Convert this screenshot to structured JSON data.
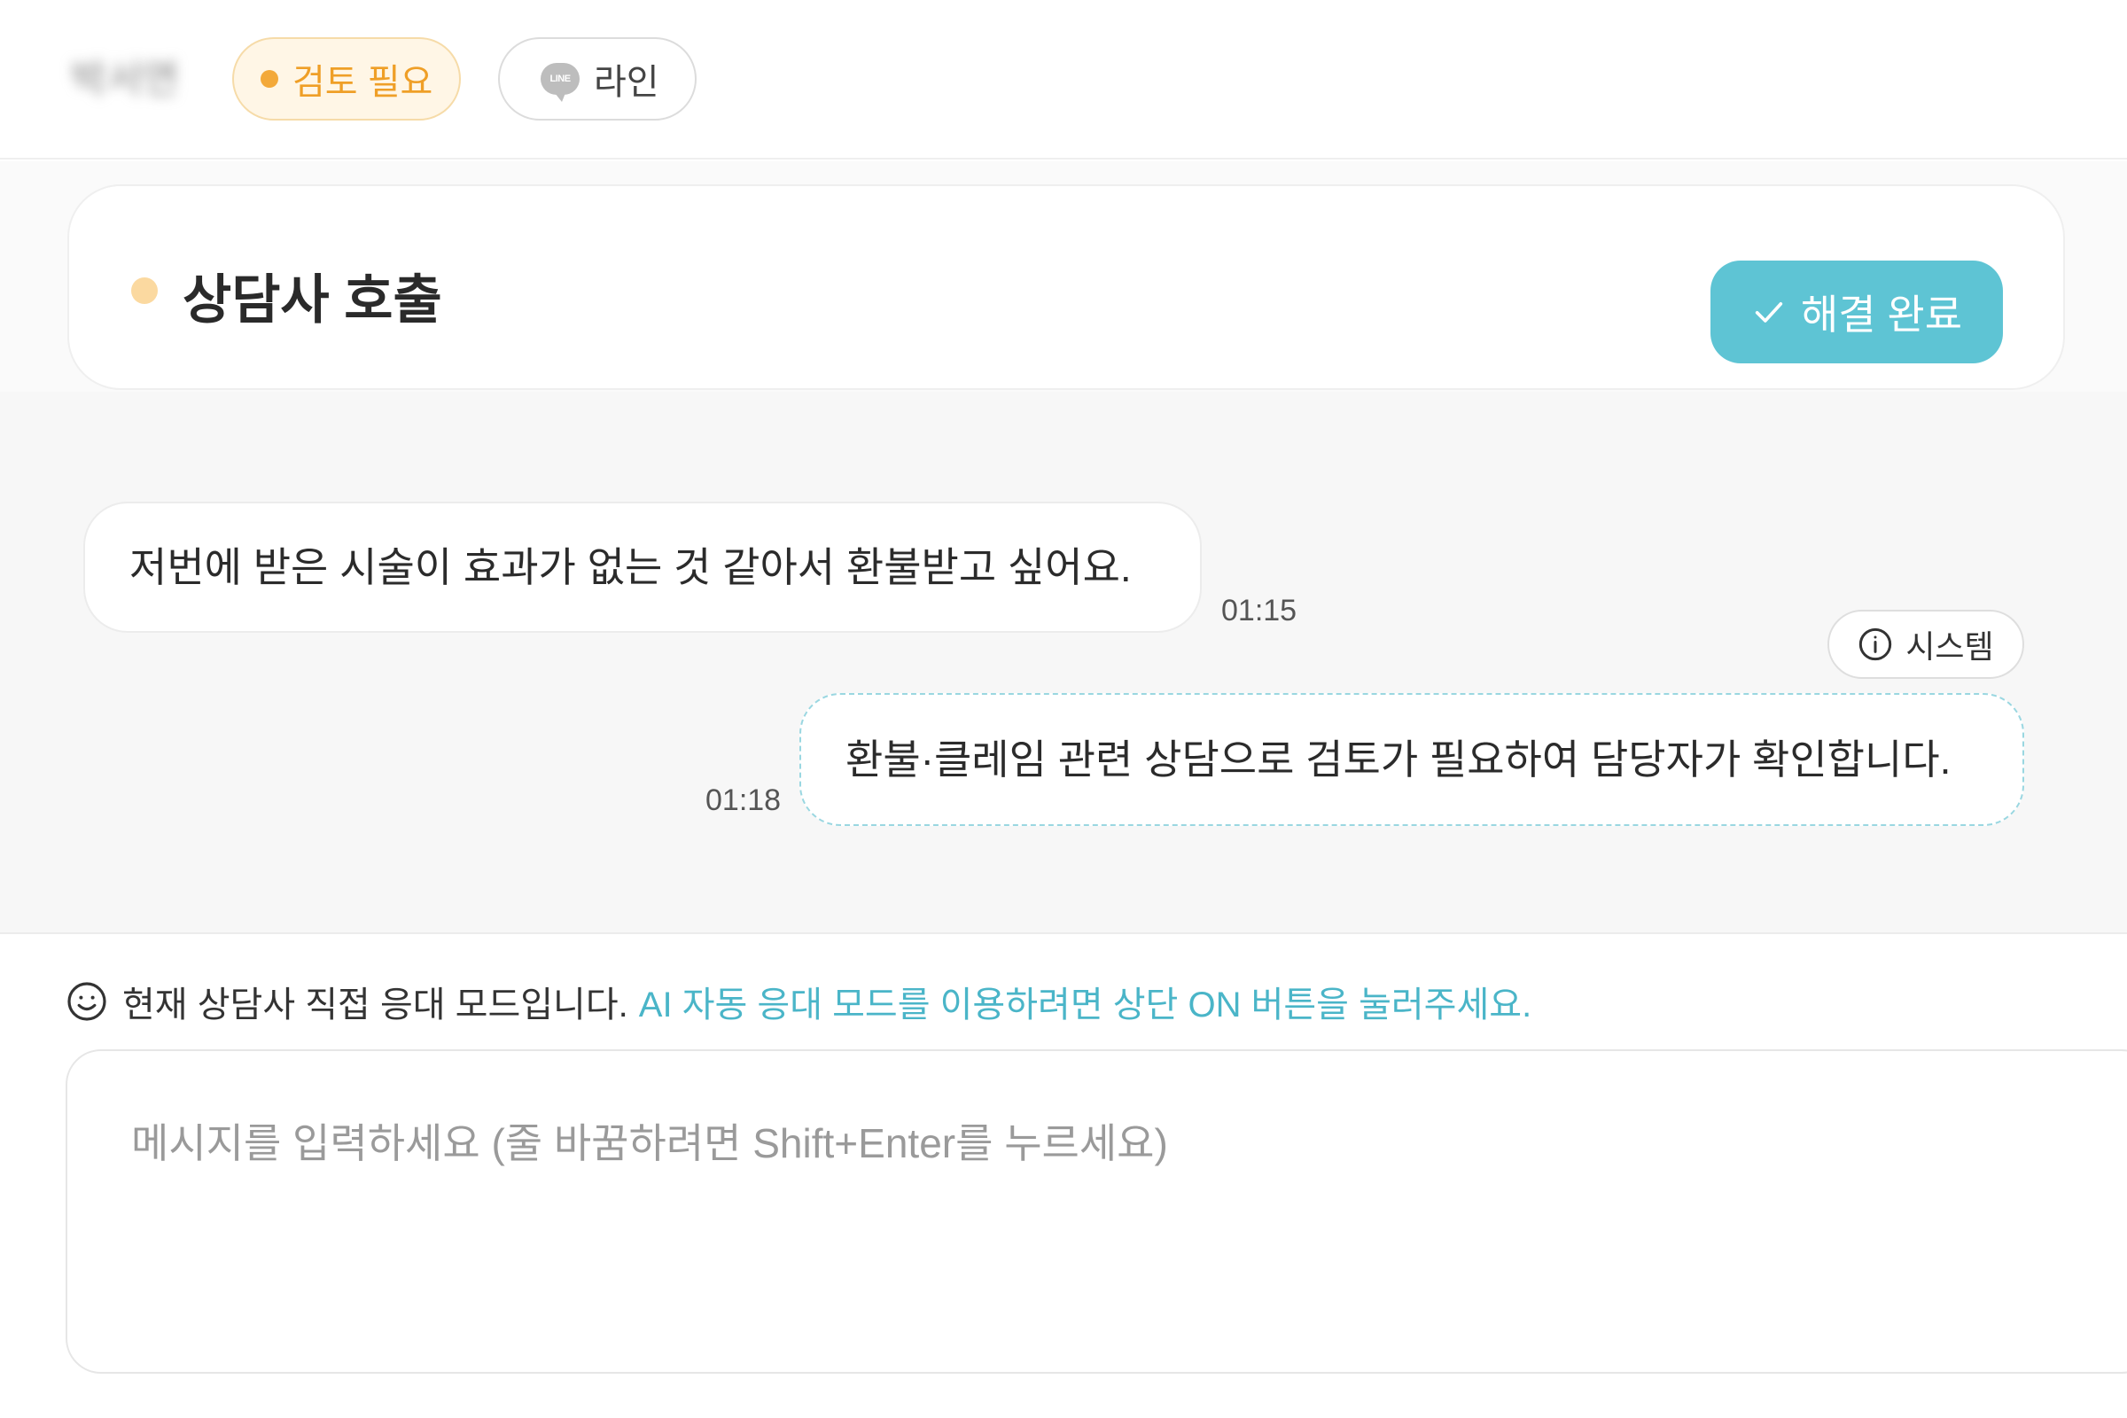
{
  "header": {
    "user_name": "박서연",
    "status_label": "검토 필요",
    "channel_label": "라인",
    "channel_icon_text": "LINE"
  },
  "call": {
    "title": "상담사 호출",
    "resolve_label": "해결 완료"
  },
  "messages": [
    {
      "type": "user",
      "text": "저번에 받은 시술이 효과가 없는 것 같아서 환불받고 싶어요.",
      "time": "01:15"
    },
    {
      "type": "system",
      "badge": "시스템",
      "text": "환불·클레임 관련 상담으로 검토가 필요하여 담당자가 확인합니다.",
      "time": "01:18"
    }
  ],
  "mode_notice": {
    "text": "현재 상담사 직접 응대 모드입니다.",
    "link": "AI 자동 응대 모드를 이용하려면 상단 ON 버튼을 눌러주세요."
  },
  "input": {
    "placeholder": "메시지를 입력하세요 (줄 바꿈하려면 Shift+Enter를 누르세요)",
    "value": ""
  },
  "colors": {
    "accent": "#5ec4d4",
    "review": "#ef9f27",
    "system_border": "#9ad7e1"
  }
}
